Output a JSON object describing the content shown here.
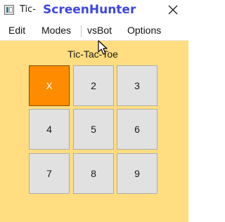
{
  "window": {
    "title": "Tic-",
    "watermark": "ScreenHunter",
    "close_icon": "close-icon"
  },
  "menu": {
    "items": [
      "Edit",
      "Modes",
      "vsBot",
      "Options"
    ]
  },
  "game": {
    "title": "Tic-Tac-Toe",
    "cells": [
      "X",
      "2",
      "3",
      "4",
      "5",
      "6",
      "7",
      "8",
      "9"
    ]
  },
  "colors": {
    "board_background": "#ffdd80",
    "cell_background": "#e1e1e1",
    "active_cell": "#ff8c00",
    "watermark": "#3d46e3"
  }
}
